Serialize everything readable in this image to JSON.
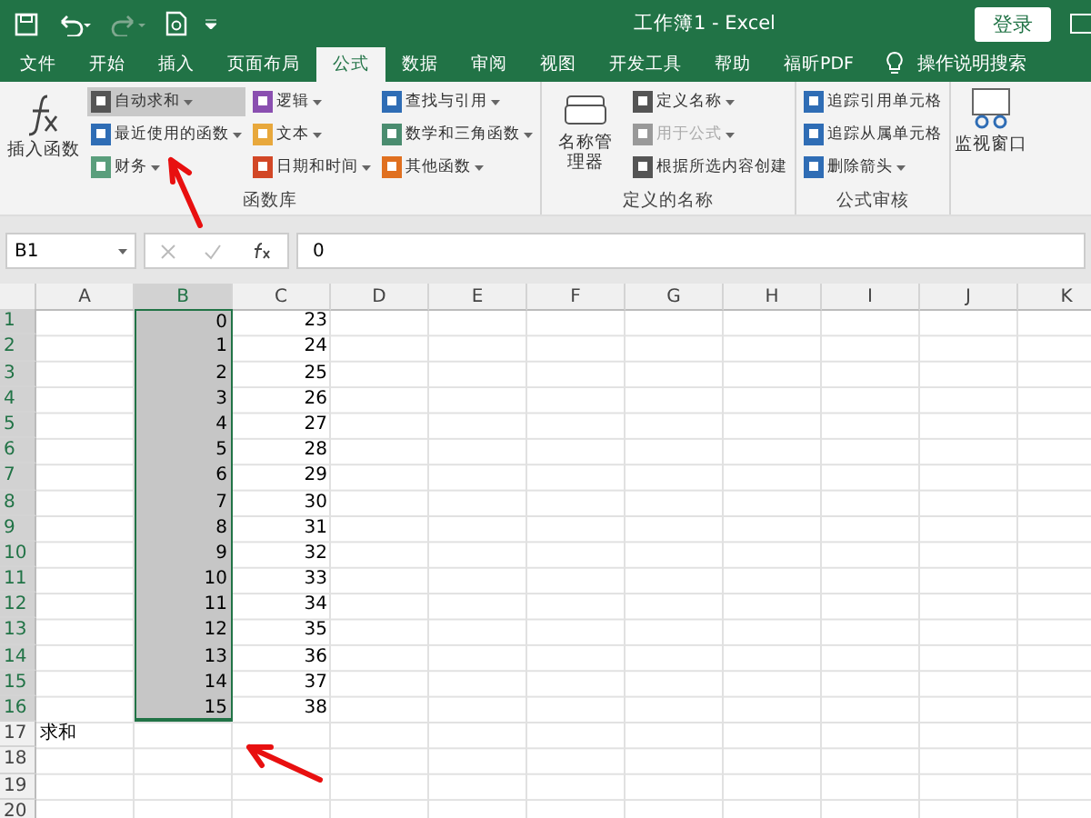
{
  "title_bar": {
    "title": "工作簿1  -  Excel",
    "login_button": "登录"
  },
  "tabs": [
    {
      "label": "文件",
      "selected": false
    },
    {
      "label": "开始",
      "selected": false
    },
    {
      "label": "插入",
      "selected": false
    },
    {
      "label": "页面布局",
      "selected": false
    },
    {
      "label": "公式",
      "selected": true
    },
    {
      "label": "数据",
      "selected": false
    },
    {
      "label": "审阅",
      "selected": false
    },
    {
      "label": "视图",
      "selected": false
    },
    {
      "label": "开发工具",
      "selected": false
    },
    {
      "label": "帮助",
      "selected": false
    },
    {
      "label": "福昕PDF",
      "selected": false
    }
  ],
  "tell_me": "操作说明搜索",
  "ribbon": {
    "groups": [
      {
        "name": "函数库",
        "big": {
          "label": "插入函数"
        },
        "columns": [
          [
            {
              "label": "自动求和",
              "color": "#555555",
              "dropdown": true,
              "highlighted": true,
              "disabled": false
            },
            {
              "label": "最近使用的函数",
              "color": "#2f6db5",
              "dropdown": true,
              "highlighted": false,
              "disabled": false
            },
            {
              "label": "财务",
              "color": "#5a9e7c",
              "dropdown": true,
              "highlighted": false,
              "disabled": false
            }
          ],
          [
            {
              "label": "逻辑",
              "color": "#8a4fb0",
              "dropdown": true,
              "highlighted": false,
              "disabled": false
            },
            {
              "label": "文本",
              "color": "#e8a83c",
              "dropdown": true,
              "highlighted": false,
              "disabled": false
            },
            {
              "label": "日期和时间",
              "color": "#d24726",
              "dropdown": true,
              "highlighted": false,
              "disabled": false
            }
          ],
          [
            {
              "label": "查找与引用",
              "color": "#2f6db5",
              "dropdown": true,
              "highlighted": false,
              "disabled": false
            },
            {
              "label": "数学和三角函数",
              "color": "#4a8c6f",
              "dropdown": true,
              "highlighted": false,
              "disabled": false
            },
            {
              "label": "其他函数",
              "color": "#e07020",
              "dropdown": true,
              "highlighted": false,
              "disabled": false
            }
          ]
        ]
      },
      {
        "name": "定义的名称",
        "big": {
          "label": "名称管理器"
        },
        "columns": [
          [
            {
              "label": "定义名称",
              "color": "#555555",
              "dropdown": true,
              "highlighted": false,
              "disabled": false
            },
            {
              "label": "用于公式",
              "color": "#999999",
              "dropdown": true,
              "highlighted": false,
              "disabled": true
            },
            {
              "label": "根据所选内容创建",
              "color": "#555555",
              "dropdown": false,
              "highlighted": false,
              "disabled": false
            }
          ]
        ]
      },
      {
        "name": "公式审核",
        "columns": [
          [
            {
              "label": "追踪引用单元格",
              "color": "#2f6db5",
              "dropdown": false,
              "highlighted": false,
              "disabled": false
            },
            {
              "label": "追踪从属单元格",
              "color": "#2f6db5",
              "dropdown": false,
              "highlighted": false,
              "disabled": false
            },
            {
              "label": "删除箭头",
              "color": "#2f6db5",
              "dropdown": true,
              "highlighted": false,
              "disabled": false
            }
          ]
        ]
      }
    ],
    "watch_window": "监视窗口"
  },
  "formula_bar": {
    "name_box": "B1",
    "value": "0"
  },
  "sheet": {
    "columns": [
      "A",
      "B",
      "C",
      "D",
      "E",
      "F",
      "G",
      "H",
      "I",
      "J",
      "K"
    ],
    "rows": [
      {
        "header": "1",
        "selected": true,
        "cells": [
          "",
          "0",
          "23"
        ]
      },
      {
        "header": "2",
        "selected": true,
        "cells": [
          "",
          "1",
          "24"
        ]
      },
      {
        "header": "3",
        "selected": true,
        "cells": [
          "",
          "2",
          "25"
        ]
      },
      {
        "header": "4",
        "selected": true,
        "cells": [
          "",
          "3",
          "26"
        ]
      },
      {
        "header": "5",
        "selected": true,
        "cells": [
          "",
          "4",
          "27"
        ]
      },
      {
        "header": "6",
        "selected": true,
        "cells": [
          "",
          "5",
          "28"
        ]
      },
      {
        "header": "7",
        "selected": true,
        "cells": [
          "",
          "6",
          "29"
        ]
      },
      {
        "header": "8",
        "selected": true,
        "cells": [
          "",
          "7",
          "30"
        ]
      },
      {
        "header": "9",
        "selected": true,
        "cells": [
          "",
          "8",
          "31"
        ]
      },
      {
        "header": "10",
        "selected": true,
        "cells": [
          "",
          "9",
          "32"
        ]
      },
      {
        "header": "11",
        "selected": true,
        "cells": [
          "",
          "10",
          "33"
        ]
      },
      {
        "header": "12",
        "selected": true,
        "cells": [
          "",
          "11",
          "34"
        ]
      },
      {
        "header": "13",
        "selected": true,
        "cells": [
          "",
          "12",
          "35"
        ]
      },
      {
        "header": "14",
        "selected": true,
        "cells": [
          "",
          "13",
          "36"
        ]
      },
      {
        "header": "15",
        "selected": true,
        "cells": [
          "",
          "14",
          "37"
        ]
      },
      {
        "header": "16",
        "selected": true,
        "cells": [
          "",
          "15",
          "38"
        ]
      },
      {
        "header": "17",
        "selected": false,
        "cells": [
          "求和",
          "",
          ""
        ]
      },
      {
        "header": "18",
        "selected": false,
        "cells": [
          "",
          "",
          ""
        ]
      },
      {
        "header": "19",
        "selected": false,
        "cells": [
          "",
          "",
          ""
        ]
      },
      {
        "header": "20",
        "selected": false,
        "cells": [
          "",
          "",
          ""
        ]
      }
    ]
  }
}
